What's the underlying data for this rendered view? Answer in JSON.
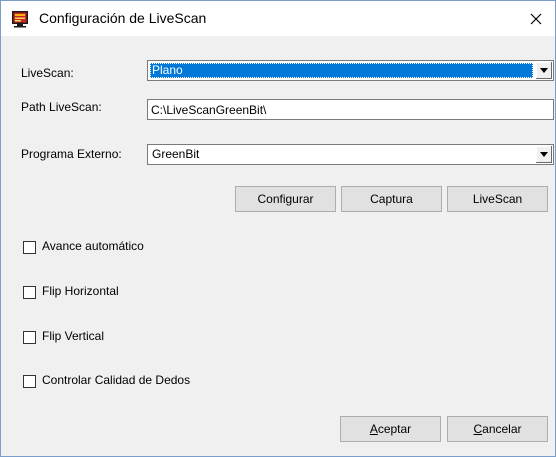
{
  "window": {
    "title": "Configuración de LiveScan",
    "icon": "livescan-app-icon",
    "close_icon": "close-icon"
  },
  "fields": {
    "livescan_label": "LiveScan:",
    "livescan_value": "Plano",
    "path_label": "Path LiveScan:",
    "path_value": "C:\\LiveScanGreenBit\\",
    "programa_label": "Programa Externo:",
    "programa_value": "GreenBit"
  },
  "buttons": {
    "configurar": "Configurar",
    "captura": "Captura",
    "livescan": "LiveScan",
    "aceptar_mnemonic": "A",
    "aceptar_rest": "ceptar",
    "cancelar_mnemonic": "C",
    "cancelar_rest": "ancelar"
  },
  "checkboxes": [
    {
      "label": "Avance automático",
      "checked": false
    },
    {
      "label": "Flip Horizontal",
      "checked": false
    },
    {
      "label": "Flip Vertical",
      "checked": false
    },
    {
      "label": "Controlar Calidad de Dedos",
      "checked": false
    }
  ],
  "colors": {
    "selection": "#0078d7",
    "dialog_bg": "#f0f0f0",
    "window_border": "#7a9ec9"
  }
}
